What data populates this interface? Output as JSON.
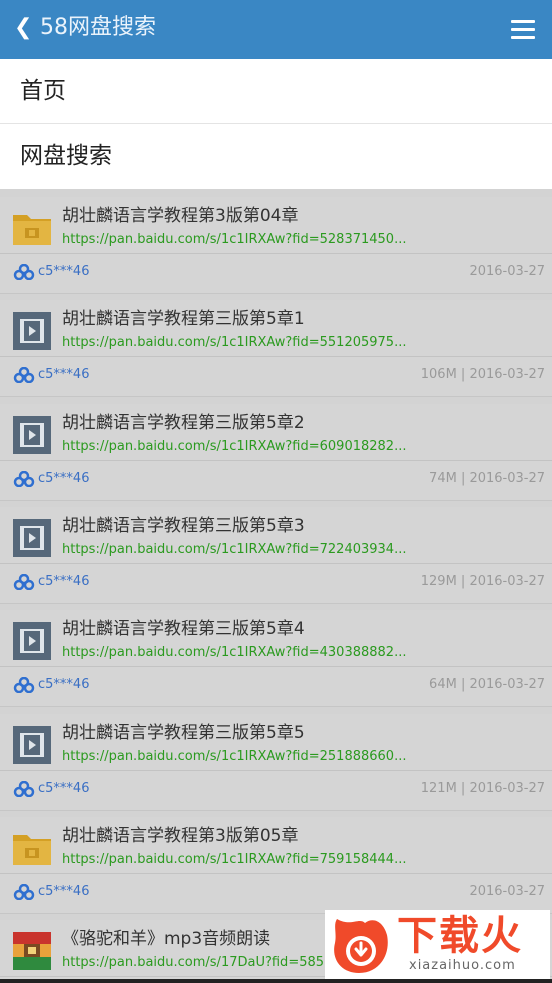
{
  "header": {
    "back_glyph": "❮",
    "title": "58网盘搜索",
    "menu_icon": "hamburger-menu-icon"
  },
  "nav": {
    "items": [
      "首页",
      "网盘搜索"
    ]
  },
  "results": [
    {
      "icon": "folder",
      "title": "胡壮麟语言学教程第3版第04章",
      "link": "https://pan.baidu.com/s/1c1IRXAw?fid=528371450...",
      "owner": "c5***46",
      "meta": "2016-03-27"
    },
    {
      "icon": "video",
      "title": "胡壮麟语言学教程第三版第5章1",
      "link": "https://pan.baidu.com/s/1c1IRXAw?fid=551205975...",
      "owner": "c5***46",
      "meta": "106M | 2016-03-27"
    },
    {
      "icon": "video",
      "title": "胡壮麟语言学教程第三版第5章2",
      "link": "https://pan.baidu.com/s/1c1IRXAw?fid=609018282...",
      "owner": "c5***46",
      "meta": "74M | 2016-03-27"
    },
    {
      "icon": "video",
      "title": "胡壮麟语言学教程第三版第5章3",
      "link": "https://pan.baidu.com/s/1c1IRXAw?fid=722403934...",
      "owner": "c5***46",
      "meta": "129M | 2016-03-27"
    },
    {
      "icon": "video",
      "title": "胡壮麟语言学教程第三版第5章4",
      "link": "https://pan.baidu.com/s/1c1IRXAw?fid=430388882...",
      "owner": "c5***46",
      "meta": "64M | 2016-03-27"
    },
    {
      "icon": "video",
      "title": "胡壮麟语言学教程第三版第5章5",
      "link": "https://pan.baidu.com/s/1c1IRXAw?fid=251888660...",
      "owner": "c5***46",
      "meta": "121M | 2016-03-27"
    },
    {
      "icon": "folder",
      "title": "胡壮麟语言学教程第3版第05章",
      "link": "https://pan.baidu.com/s/1c1IRXAw?fid=759158444...",
      "owner": "c5***46",
      "meta": "2016-03-27"
    },
    {
      "icon": "archive",
      "title": "《骆驼和羊》mp3音频朗读",
      "link": "https://pan.baidu.com/s/17DaU?fid=585",
      "owner": "",
      "meta": ""
    }
  ],
  "watermark": {
    "brand": "下载火",
    "domain": "xiazaihuo.com"
  },
  "colors": {
    "header": "#3a87c4",
    "link": "#2b9a1f",
    "owner": "#3a6fc4",
    "brand": "#f04a2a"
  }
}
